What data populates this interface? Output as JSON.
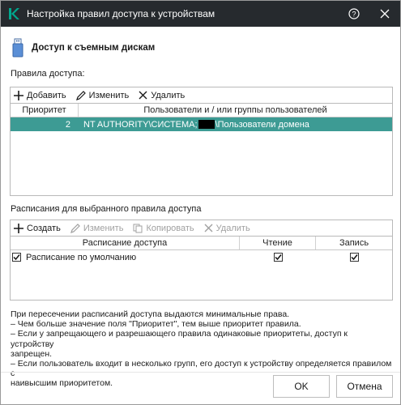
{
  "window": {
    "title": "Настройка правил доступа к устройствам",
    "help_icon": "help-icon",
    "close_icon": "close-icon"
  },
  "header": {
    "icon": "usb-drive-icon",
    "title": "Доступ к съемным дискам"
  },
  "rules": {
    "label": "Правила доступа:",
    "toolbar": {
      "add": "Добавить",
      "edit": "Изменить",
      "delete": "Удалить"
    },
    "columns": [
      "Приоритет",
      "Пользователи и / или группы пользователей"
    ],
    "rows": [
      {
        "priority": "2",
        "users_prefix": "NT AUTHORITY\\СИСТЕМА;",
        "users_suffix": "\\Пользователи домена",
        "selected": true
      }
    ]
  },
  "schedules": {
    "label": "Расписания для выбранного правила доступа",
    "toolbar": {
      "create": "Создать",
      "edit": "Изменить",
      "copy": "Копировать",
      "delete": "Удалить"
    },
    "columns": [
      "Расписание доступа",
      "Чтение",
      "Запись"
    ],
    "rows": [
      {
        "name": "Расписание по умолчанию",
        "enabled": true,
        "read": true,
        "write": true
      }
    ]
  },
  "info": {
    "lines": [
      "При пересечении расписаний доступа выдаются минимальные права.",
      "– Чем больше значение поля \"Приоритет\", тем выше приоритет правила.",
      "– Если у запрещающего и разрешающего правила одинаковые приоритеты, доступ к устройству",
      "запрещен.",
      "– Если пользователь входит в несколько групп, его доступ к устройству определяется правилом с",
      "наивысшим приоритетом."
    ]
  },
  "footer": {
    "ok": "OK",
    "cancel": "Отмена"
  },
  "colors": {
    "titlebar": "#262a2e",
    "accent": "#00a88e",
    "selection": "#3d9b94"
  }
}
